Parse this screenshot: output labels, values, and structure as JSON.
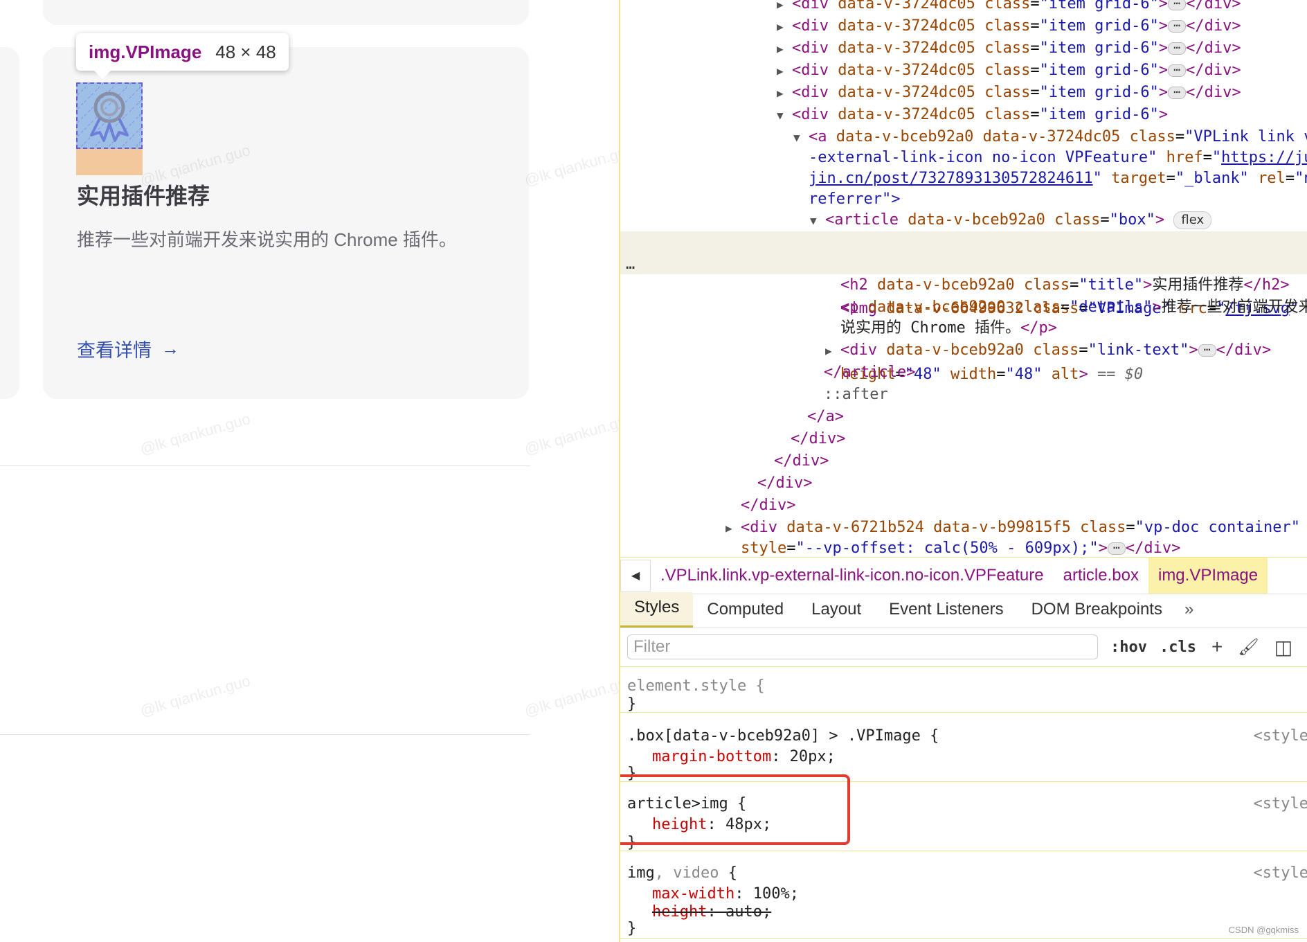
{
  "left_page": {
    "tooltip": {
      "name": "img.VPImage",
      "size": "48 × 48"
    },
    "card": {
      "title": "实用插件推荐",
      "details": "推荐一些对前端开发来说实用的 Chrome 插件。",
      "link_text": "查看详情",
      "link_arrow": "→",
      "image_icon": "badge-icon"
    },
    "watermark": "@lk qiankun.guo"
  },
  "elements_panel": {
    "lines": [
      {
        "tri": "▶",
        "indent": 220,
        "html": "collapsed",
        "text": "<div data-v-3724dc05 class=\"item grid-6\">"
      },
      {
        "tri": "▶",
        "indent": 220,
        "text": "<div data-v-3724dc05 class=\"item grid-6\">"
      },
      {
        "tri": "▶",
        "indent": 220,
        "text": "<div data-v-3724dc05 class=\"item grid-6\">"
      },
      {
        "tri": "▶",
        "indent": 220,
        "text": "<div data-v-3724dc05 class=\"item grid-6\">"
      },
      {
        "tri": "▶",
        "indent": 220,
        "text": "<div data-v-3724dc05 class=\"item grid-6\">"
      }
    ],
    "div_tag": "div",
    "div_attr": "data-v-3724dc05",
    "div_class_attr": "class",
    "div_class_val": "\"item grid-6\"",
    "a_line1": {
      "tag": "a",
      "attrs": "data-v-bceb92a0 data-v-3724dc05",
      "class_attr": "class",
      "class_val": "\"VPLink link v"
    },
    "a_line2": "-external-link-icon no-icon VPFeature\"",
    "a_href_attr": "href",
    "a_href_val": "https://ju",
    "a_line3_link": "jin.cn/post/7327893130572824611",
    "a_target_attr": "target",
    "a_target_val": "\"_blank\"",
    "a_rel_attr": "rel",
    "a_rel_val": "\"n",
    "a_line4": "referrer\">",
    "article": {
      "tag": "article",
      "attr": "data-v-bceb92a0",
      "class_attr": "class",
      "class_val": "\"box\"",
      "badge": "flex"
    },
    "img1": {
      "tag": "img",
      "attr": "data-v-66499632",
      "class_attr": "class",
      "class_val": "\"VPImage\"",
      "src_attr": "src",
      "src_val": "/tj.svg"
    },
    "img2": {
      "h_attr": "height",
      "h_val": "\"48\"",
      "w_attr": "width",
      "w_val": "\"48\"",
      "alt_attr": "alt",
      "dollar": "== $0"
    },
    "h2": {
      "tag": "h2",
      "attr": "data-v-bceb92a0",
      "class_attr": "class",
      "class_val": "\"title\"",
      "text": "实用插件推荐"
    },
    "p1": {
      "tag": "p",
      "attr": "data-v-bceb92a0",
      "class_attr": "class",
      "class_val": "\"details\"",
      "text": "推荐一些对前端开发来"
    },
    "p2": "说实用的 Chrome 插件。",
    "linktext": {
      "tag": "div",
      "attr": "data-v-bceb92a0",
      "class_attr": "class",
      "class_val": "\"link-text\""
    },
    "close_article": "</article>",
    "after": "::after",
    "close_a": "</a>",
    "close_div": "</div>",
    "vpdoc1": {
      "tag": "div",
      "attrs": "data-v-6721b524 data-v-b99815f5",
      "class_attr": "class",
      "class_val": "\"vp-doc container\""
    },
    "vpdoc2_attr": "style",
    "vpdoc2_val": "\"--vp-offset: calc(50% - 609px);\"",
    "gutter_dots": "…",
    "ellipsis": "⋯"
  },
  "breadcrumb": {
    "back": "◀",
    "items": [
      ".VPLink.link.vp-external-link-icon.no-icon.VPFeature",
      "article.box",
      "img.VPImage"
    ]
  },
  "tabs": [
    "Styles",
    "Computed",
    "Layout",
    "Event Listeners",
    "DOM Breakpoints",
    "»"
  ],
  "filter": {
    "placeholder": "Filter",
    "hov": ":hov",
    "cls": ".cls",
    "plus": "+",
    "paint": "🖌",
    "sidebar": "◫"
  },
  "styles": {
    "element_style": "element.style {",
    "close": "}",
    "rule1_selector": ".box[data-v-bceb92a0] > .VPImage {",
    "rule1_prop": "margin-bottom",
    "rule1_val": ": 20px;",
    "rule2_selector": "article>img {",
    "rule2_prop": "height",
    "rule2_val": ": 48px;",
    "rule3_selector_a": "img",
    "rule3_selector_b": ", video",
    "rule3_selector_c": " {",
    "rule3_prop1": "max-width",
    "rule3_val1": ": 100%;",
    "rule3_prop2": "height",
    "rule3_val2": ": auto;",
    "origin": "<style"
  },
  "footer": "CSDN @gqkmiss",
  "colors": {
    "accent_link": "#3451b2",
    "tag": "#881280",
    "attr": "#994500",
    "value": "#1a1aa6",
    "highlight": "#e03b2f"
  }
}
